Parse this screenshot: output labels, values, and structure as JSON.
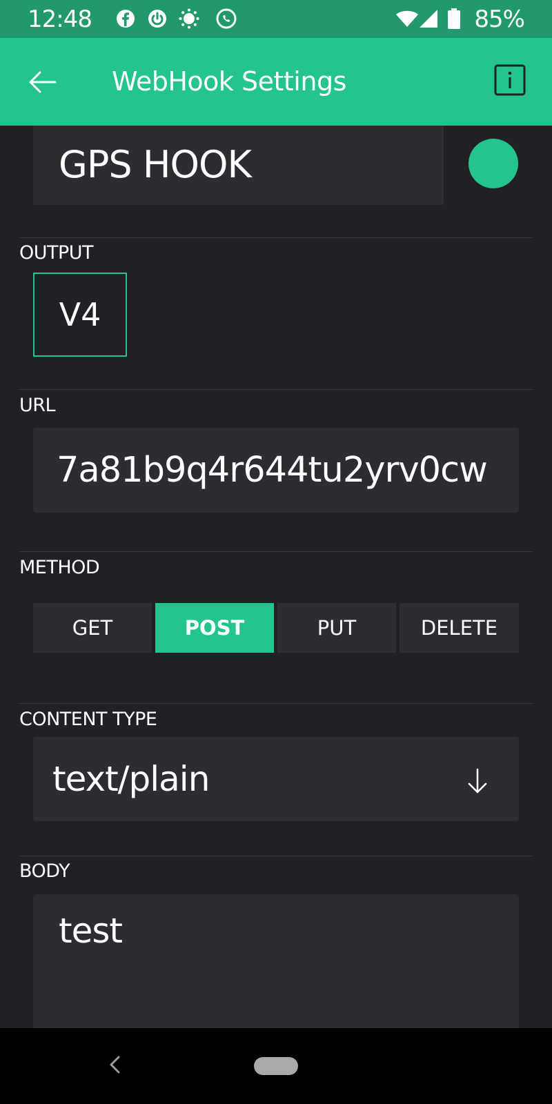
{
  "status_bar": {
    "time": "12:48",
    "battery_percent": "85%",
    "icons": [
      "facebook-icon",
      "power-icon",
      "brightness-icon",
      "call-icon",
      "wifi-icon",
      "signal-icon",
      "battery-icon"
    ]
  },
  "app_bar": {
    "title": "WebHook Settings",
    "back_icon": "arrow-left-icon",
    "info_icon": "info-icon"
  },
  "widget": {
    "name": "GPS HOOK",
    "color": "#23c48e"
  },
  "output": {
    "label": "OUTPUT",
    "pin": "V4"
  },
  "url": {
    "label": "URL",
    "value": "7a81b9q4r644tu2yrv0cw"
  },
  "method": {
    "label": "METHOD",
    "options": [
      "GET",
      "POST",
      "PUT",
      "DELETE"
    ],
    "selected": "POST"
  },
  "content_type": {
    "label": "CONTENT TYPE",
    "value": "text/plain"
  },
  "body": {
    "label": "BODY",
    "value": "test"
  },
  "colors": {
    "accent": "#23c48e",
    "status_bar": "#22996b",
    "background": "#1f2125",
    "field": "#2b2d32"
  }
}
